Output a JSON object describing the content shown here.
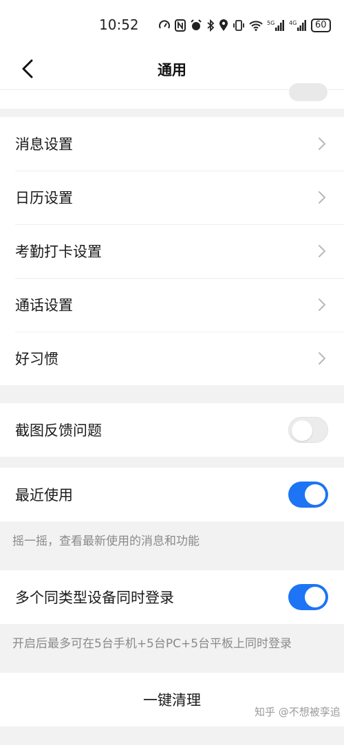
{
  "status_bar": {
    "time": "10:52",
    "icons": [
      "speed-icon",
      "nfc-icon",
      "alarm-icon",
      "bluetooth-icon",
      "location-icon",
      "vibrate-icon",
      "wifi-icon",
      "signal-5g-icon",
      "signal-4g-icon"
    ],
    "battery": "60"
  },
  "nav": {
    "title": "通用",
    "back_icon": "chevron-left-icon"
  },
  "settings_list": [
    {
      "label": "消息设置"
    },
    {
      "label": "日历设置"
    },
    {
      "label": "考勤打卡设置"
    },
    {
      "label": "通话设置"
    },
    {
      "label": "好习惯"
    }
  ],
  "screenshot_feedback": {
    "label": "截图反馈问题",
    "enabled": false
  },
  "recent_use": {
    "label": "最近使用",
    "enabled": true,
    "hint": "摇一摇，查看最新使用的消息和功能"
  },
  "multi_device": {
    "label": "多个同类型设备同时登录",
    "enabled": true,
    "hint": "开启后最多可在5台手机+5台PC+5台平板上同时登录"
  },
  "clean_button": {
    "label": "一键清理"
  },
  "watermark": "知乎 @不想被孪追",
  "colors": {
    "accent": "#1d74f5",
    "background": "#f2f2f2",
    "hint_text": "#8a8a8a"
  }
}
